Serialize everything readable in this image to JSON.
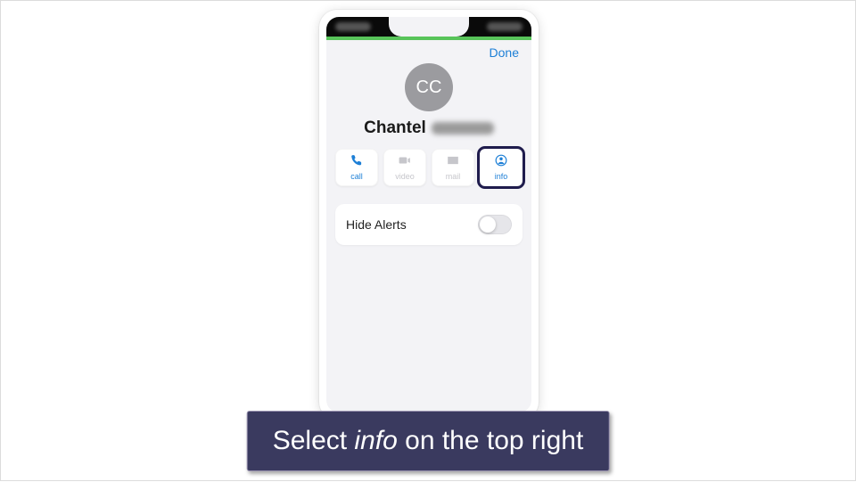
{
  "nav": {
    "done": "Done"
  },
  "contact": {
    "initials": "CC",
    "first_name": "Chantel"
  },
  "actions": {
    "call": "call",
    "video": "video",
    "mail": "mail",
    "info": "info"
  },
  "settings": {
    "hide_alerts_label": "Hide Alerts",
    "hide_alerts_on": false
  },
  "caption": {
    "pre": "Select ",
    "em": "info",
    "post": " on the top right"
  },
  "colors": {
    "link": "#1d7fd6",
    "overlay": "#3a3a5f",
    "highlight": "#1f1c4d"
  }
}
